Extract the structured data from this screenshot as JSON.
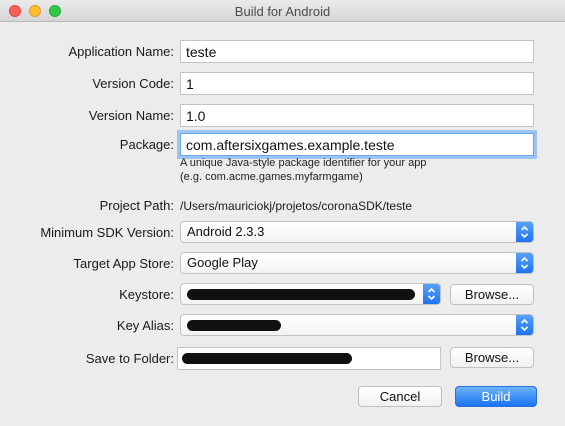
{
  "window": {
    "title": "Build for Android"
  },
  "form": {
    "app_name_label": "Application Name:",
    "app_name_value": "teste",
    "version_code_label": "Version Code:",
    "version_code_value": "1",
    "version_name_label": "Version Name:",
    "version_name_value": "1.0",
    "package_label": "Package:",
    "package_value": "com.aftersixgames.example.teste",
    "package_hint_line1": "A unique Java-style package identifier for your app",
    "package_hint_line2": "(e.g. com.acme.games.myfarmgame)",
    "project_path_label": "Project Path:",
    "project_path_value": "/Users/mauriciokj/projetos/coronaSDK/teste",
    "min_sdk_label": "Minimum SDK Version:",
    "min_sdk_value": "Android 2.3.3",
    "target_store_label": "Target App Store:",
    "target_store_value": "Google Play",
    "keystore_label": "Keystore:",
    "keystore_browse": "Browse...",
    "key_alias_label": "Key Alias:",
    "save_folder_label": "Save to Folder:",
    "save_folder_browse": "Browse..."
  },
  "actions": {
    "cancel": "Cancel",
    "build": "Build"
  },
  "colors": {
    "accent": "#1a74f3",
    "focus_ring": "#9ec4f3"
  }
}
